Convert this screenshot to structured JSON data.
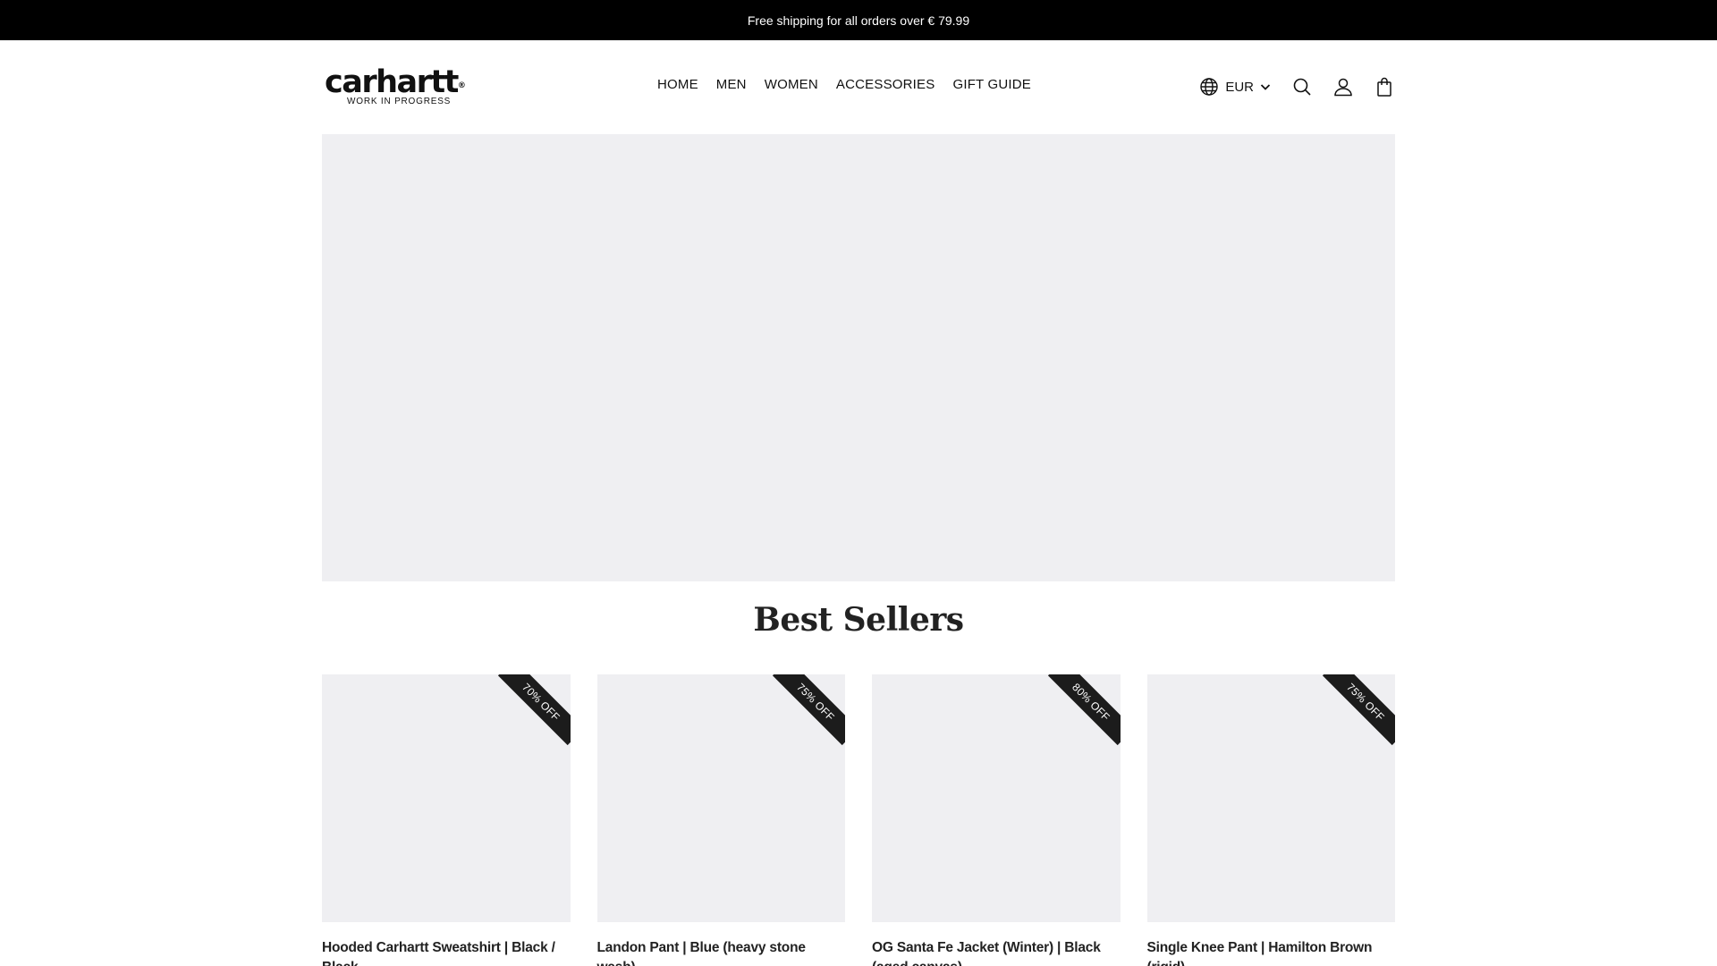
{
  "announcement": {
    "text": "Free shipping for all orders over € 79.99"
  },
  "brand": {
    "wordmark": "carhartt",
    "registered": "®",
    "tagline": "WORK IN PROGRESS"
  },
  "nav": {
    "items": [
      {
        "label": "HOME"
      },
      {
        "label": "MEN"
      },
      {
        "label": "WOMEN"
      },
      {
        "label": "ACCESSORIES"
      },
      {
        "label": "GIFT GUIDE"
      }
    ]
  },
  "utilities": {
    "currency": "EUR",
    "icons": [
      "globe-icon",
      "chevron-down-icon",
      "search-icon",
      "account-icon",
      "cart-icon"
    ]
  },
  "hero": {
    "background": "#efeff2"
  },
  "best_sellers": {
    "title": "Best Sellers",
    "products": [
      {
        "title": "Hooded Carhartt Sweatshirt | Black / Black",
        "badge": "70% OFF"
      },
      {
        "title": "Landon Pant | Blue (heavy stone wash)",
        "badge": "75% OFF"
      },
      {
        "title": "OG Santa Fe Jacket (Winter) | Black (aged canvas)",
        "badge": "80% OFF"
      },
      {
        "title": "Single Knee Pant | Hamilton Brown (rigid)",
        "badge": "75% OFF"
      }
    ]
  },
  "colors": {
    "announcement_bg": "#000000",
    "placeholder_bg": "#efeff2",
    "badge_bg": "#1c1c1c"
  }
}
